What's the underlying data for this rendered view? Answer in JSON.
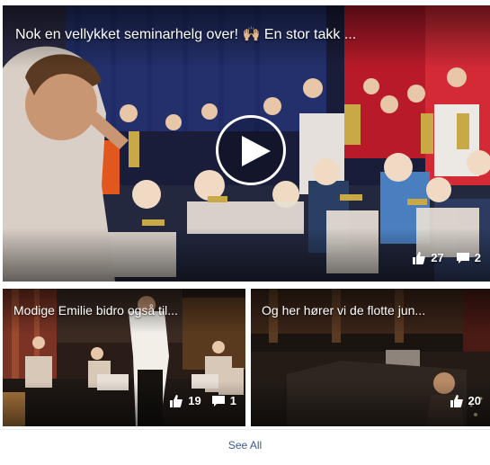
{
  "main_video": {
    "title": "Nok en vellykket seminarhelg over! 🙌🏼 En stor takk ...",
    "likes": "27",
    "comments": "2"
  },
  "videos": [
    {
      "title": "Modige Emilie bidro også til...",
      "likes": "19",
      "comments": "1"
    },
    {
      "title": "Og her hører vi de flotte jun...",
      "likes": "20"
    }
  ],
  "footer": {
    "see_all_label": "See All"
  },
  "colors": {
    "link": "#385898",
    "overlay_text": "#ffffff",
    "curtain_red": "#c4202b"
  }
}
